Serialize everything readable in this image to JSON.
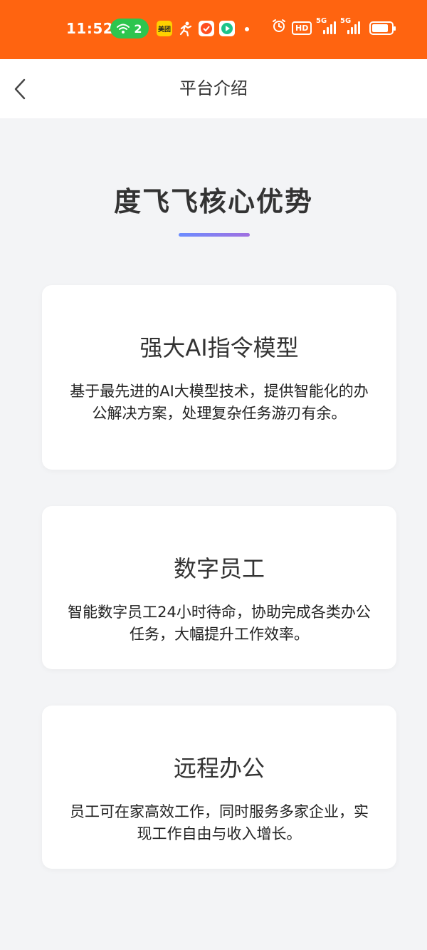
{
  "status_bar": {
    "time": "11:52",
    "wifi_count": "2",
    "meituan_label": "美团",
    "hd_label": "HD",
    "signal1_label": "5G",
    "signal2_label": "5G",
    "icons": [
      "wifi-icon",
      "meituan-icon",
      "running-icon",
      "taobao-icon",
      "video-icon",
      "alarm-icon",
      "hd-icon",
      "signal-icon",
      "signal-icon",
      "battery-icon"
    ],
    "battery_level": 0.85,
    "bar_color": "#ff6410"
  },
  "nav": {
    "title": "平台介绍",
    "back_icon": "chevron-left-icon"
  },
  "section": {
    "title": "度飞飞核心优势",
    "underline_colors": [
      "#6b8cff",
      "#a06fe0"
    ]
  },
  "cards": [
    {
      "title": "强大AI指令模型",
      "description": "基于最先进的AI大模型技术，提供智能化的办公解决方案，处理复杂任务游刃有余。"
    },
    {
      "title": "数字员工",
      "description": "智能数字员工24小时待命，协助完成各类办公任务，大幅提升工作效率。"
    },
    {
      "title": "远程办公",
      "description": "员工可在家高效工作，同时服务多家企业，实现工作自由与收入增长。"
    }
  ]
}
